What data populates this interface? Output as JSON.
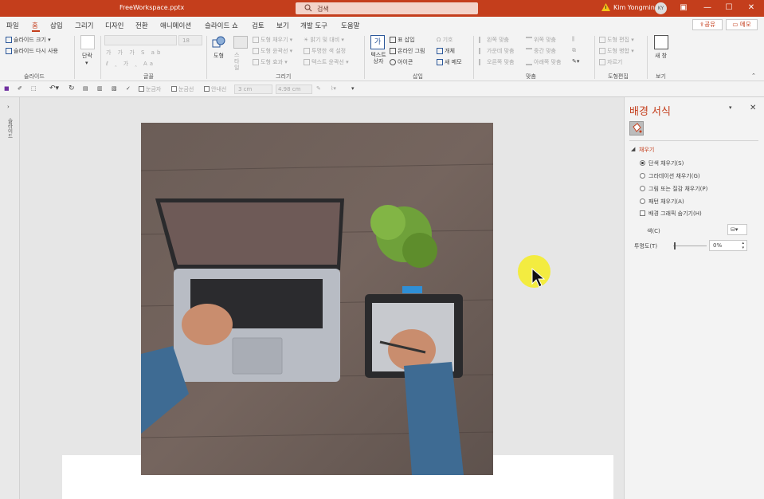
{
  "titlebar": {
    "filename": "FreeWorkspace.pptx",
    "search_placeholder": "검색",
    "user_name": "Kim Yongmin",
    "avatar_initials": "KY",
    "accent_color": "#c43e1c"
  },
  "tabs": [
    "파일",
    "홈",
    "삽입",
    "그리기",
    "디자인",
    "전환",
    "애니메이션",
    "슬라이드 쇼",
    "검토",
    "보기",
    "개발 도구",
    "도움말"
  ],
  "active_tab": "홈",
  "share_label": "공유",
  "memo_label": "메모",
  "ribbon": {
    "slides": {
      "new_size": "슬라이드 크기",
      "reuse": "슬라이드 다시 사용",
      "label": "슬라이드"
    },
    "paragraph": {
      "label": "단락"
    },
    "font": {
      "size": "18",
      "label": "글꼴"
    },
    "drawing": {
      "shape": "도형",
      "styles": "스타일",
      "fill": "도형 채우기",
      "outline": "도형 윤곽선",
      "effects": "도형 효과",
      "fill_bg": "밝기 및 대비",
      "transparent": "투명한 색 설정",
      "text_outline": "텍스트 윤곽선",
      "label": "그리기"
    },
    "insert": {
      "textbox": "텍스트 상자",
      "table": "표 삽입",
      "online_pic": "온라인 그림",
      "icon": "아이콘",
      "symbol": "기호",
      "object": "개체",
      "new_memo": "새 메모",
      "label": "삽입"
    },
    "align": {
      "left": "왼쪽 맞춤",
      "center": "가운데 맞춤",
      "right": "오른쪽 맞춤",
      "top": "위쪽 맞춤",
      "middle": "중간 맞춤",
      "bottom": "아래쪽 맞춤",
      "label": "맞춤"
    },
    "shape_edit": {
      "edit": "도형 편집",
      "merge": "도형 병합",
      "crop": "자르기",
      "label": "도형편집"
    },
    "view": {
      "new_window": "새 창",
      "label": "보기"
    }
  },
  "qat": {
    "ruler": "눈금자",
    "gridlines": "눈금선",
    "guides": "안내선",
    "height": "3 cm",
    "width": "4.98 cm"
  },
  "leftpane_text": "슬라이드",
  "panel": {
    "title": "배경 서식",
    "section": "채우기",
    "options": [
      "단색 채우기(S)",
      "그라데이션 채우기(G)",
      "그림 또는 질감 채우기(P)",
      "패턴 채우기(A)"
    ],
    "selected_option": 0,
    "hide_graphics": "배경 그래픽 숨기기(H)",
    "color_label": "색(C)",
    "transparency_label": "투명도(T)",
    "transparency_value": "0%"
  }
}
